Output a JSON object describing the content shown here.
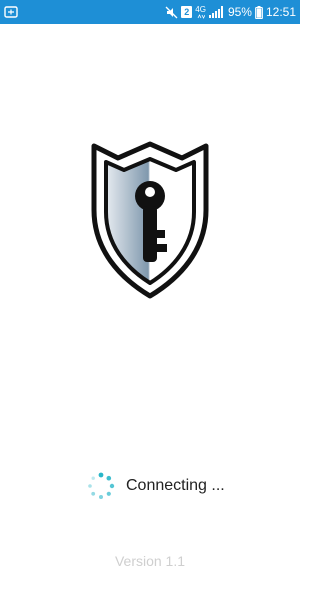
{
  "status_bar": {
    "color": "#1e8fd6",
    "left_icons": [
      "notification-app-icon"
    ],
    "right_icons": [
      "mute-icon",
      "sim2-badge",
      "lte-icon",
      "signal-icon",
      "battery-icon"
    ],
    "sim_label": "2",
    "network_label": "4G",
    "battery_percent": "95%",
    "time": "12:51"
  },
  "logo": {
    "icon": "shield-key-icon",
    "outline_color": "#111111"
  },
  "loading": {
    "label": "Connecting ...",
    "spinner_color": "#29b6c9"
  },
  "footer": {
    "version": "Version 1.1"
  }
}
